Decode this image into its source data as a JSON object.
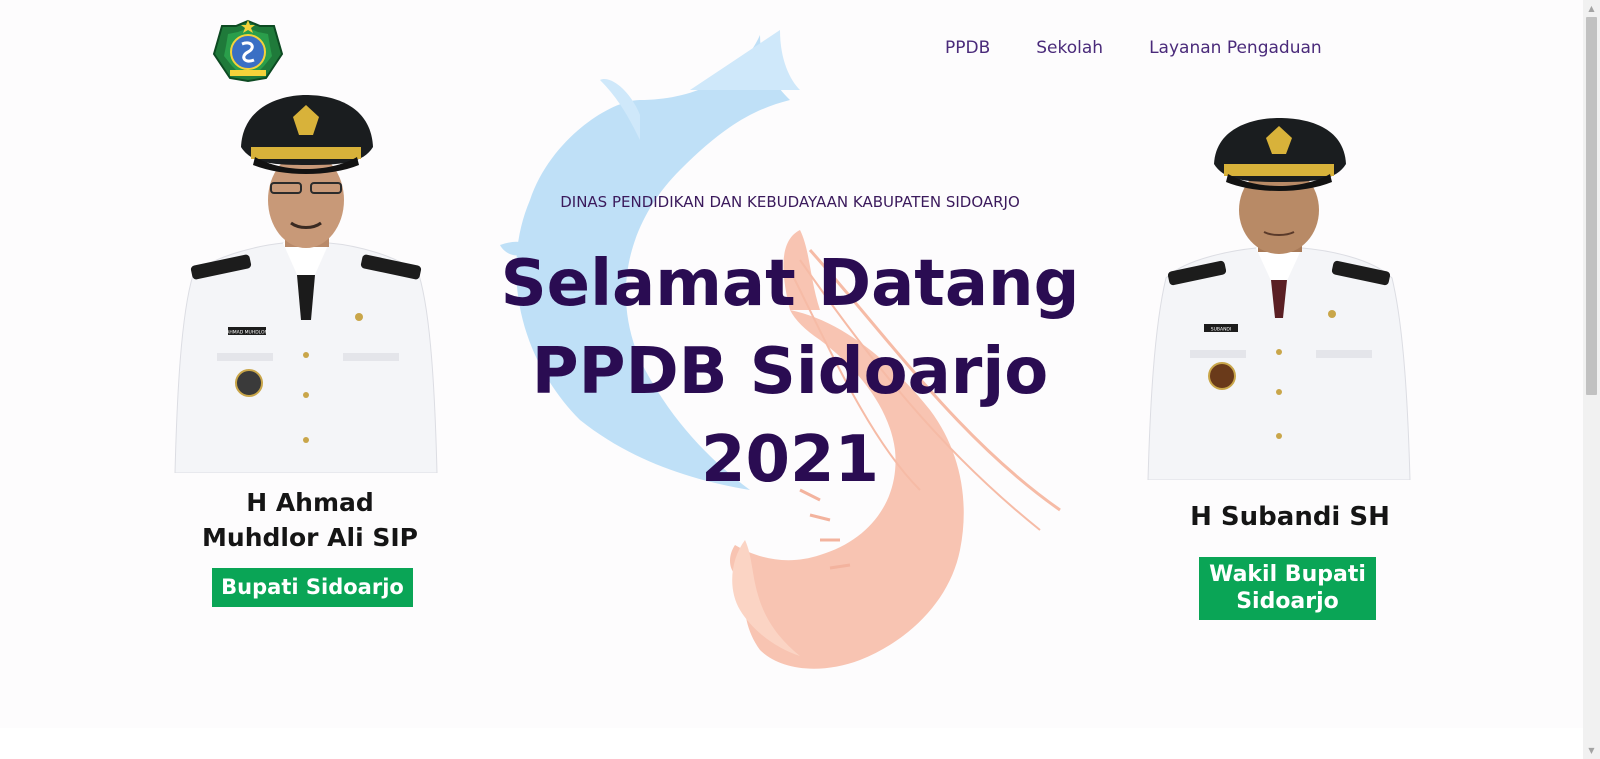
{
  "nav": {
    "items": [
      {
        "label": "PPDB"
      },
      {
        "label": "Sekolah"
      },
      {
        "label": "Layanan Pengaduan"
      }
    ]
  },
  "hero": {
    "subtitle": "DINAS PENDIDIKAN DAN KEBUDAYAAN KABUPATEN SIDOARJO",
    "headline_line1": "Selamat Datang",
    "headline_line2": "PPDB Sidoarjo",
    "headline_line3": "2021"
  },
  "officials": {
    "left": {
      "name_line1": "H Ahmad",
      "name_line2": "Muhdlor Ali SIP",
      "title": "Bupati Sidoarjo",
      "nameplate": "AHMAD MUHDLOR"
    },
    "right": {
      "name": "H Subandi SH",
      "title_line1": "Wakil Bupati",
      "title_line2": "Sidoarjo",
      "nameplate": "SUBANDI"
    }
  },
  "colors": {
    "nav_text": "#4a2a7a",
    "headline": "#2a0c52",
    "badge_green": "#0aa556"
  },
  "icons": {
    "logo": "sidoarjo-regency-emblem",
    "scroll_up": "scroll-up-arrow-icon",
    "scroll_down": "scroll-down-arrow-icon"
  }
}
